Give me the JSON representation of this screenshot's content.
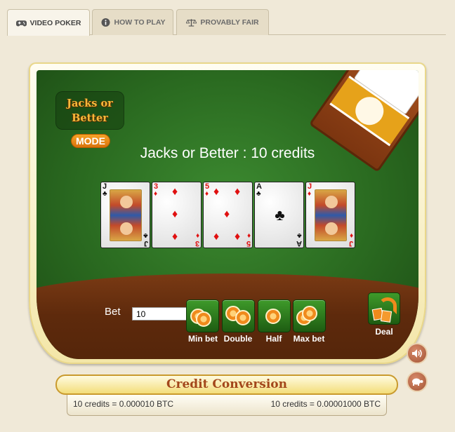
{
  "tabs": [
    {
      "label": "VIDEO POKER",
      "icon": "gamepad-icon",
      "active": true
    },
    {
      "label": "HOW TO PLAY",
      "icon": "info-icon",
      "active": false
    },
    {
      "label": "PROVABLY FAIR",
      "icon": "scales-icon",
      "active": false
    }
  ],
  "game": {
    "mode_title": "Jacks or Better",
    "mode_button": "MODE",
    "headline": "Jacks or Better : 10 credits",
    "cards": [
      {
        "rank": "J",
        "suit": "♣",
        "color": "black",
        "face": true
      },
      {
        "rank": "3",
        "suit": "♦",
        "color": "red",
        "face": false
      },
      {
        "rank": "5",
        "suit": "♦",
        "color": "red",
        "face": false
      },
      {
        "rank": "A",
        "suit": "♣",
        "color": "black",
        "face": false
      },
      {
        "rank": "J",
        "suit": "♦",
        "color": "red",
        "face": true
      }
    ]
  },
  "controls": {
    "bet_label": "Bet",
    "bet_value": "10",
    "min_bet": "Min bet",
    "double": "Double",
    "half": "Half",
    "max_bet": "Max bet",
    "deal": "Deal"
  },
  "side_buttons": {
    "sound_icon": "speaker-icon",
    "turtle_icon": "turtle-icon"
  },
  "credit_conversion": {
    "title": "Credit Conversion",
    "left": "10 credits = 0.000010 BTC",
    "right": "10 credits = 0.00001000 BTC"
  },
  "colors": {
    "felt": "#2f7424",
    "wood": "#5e2a0c",
    "accent_orange": "#f08a1c",
    "card_red": "#e01010"
  }
}
